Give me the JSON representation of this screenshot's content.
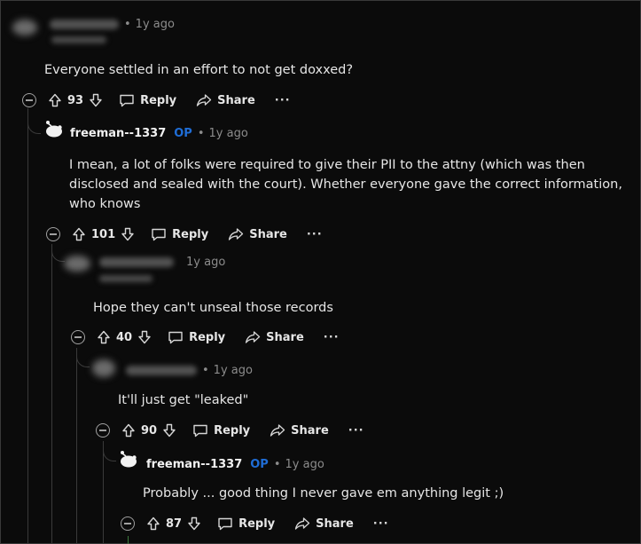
{
  "comments": [
    {
      "timestamp": "1y ago",
      "body": "Everyone settled in an effort to not get doxxed?",
      "votes": "93",
      "reply_label": "Reply",
      "share_label": "Share",
      "more_label": "···"
    },
    {
      "username": "freeman--1337",
      "badge": "OP",
      "timestamp": "1y ago",
      "body_lines": [
        "I mean, a lot of folks were required to give their PII to the attny (which was then",
        "disclosed and sealed with the court). Whether everyone gave the correct information,",
        "who knows"
      ],
      "votes": "101",
      "reply_label": "Reply",
      "share_label": "Share",
      "more_label": "···"
    },
    {
      "timestamp": "1y ago",
      "body": "Hope they can't unseal those records",
      "votes": "40",
      "reply_label": "Reply",
      "share_label": "Share",
      "more_label": "···"
    },
    {
      "timestamp": "1y ago",
      "body": "It'll just get \"leaked\"",
      "votes": "90",
      "reply_label": "Reply",
      "share_label": "Share",
      "more_label": "···"
    },
    {
      "username": "freeman--1337",
      "badge": "OP",
      "timestamp": "1y ago",
      "body": "Probably ... good thing I never gave em anything legit ;)",
      "votes": "87",
      "reply_label": "Reply",
      "share_label": "Share",
      "more_label": "···"
    }
  ],
  "colors": {
    "background": "#0b0b0b",
    "op_badge": "#1f6dd6",
    "muted": "#8c8c8c",
    "thread_line": "#3a3a3a"
  },
  "icons": [
    "upvote-icon",
    "downvote-icon",
    "reply-bubble-icon",
    "share-arrow-icon",
    "collapse-icon",
    "snoo-avatar-icon"
  ]
}
